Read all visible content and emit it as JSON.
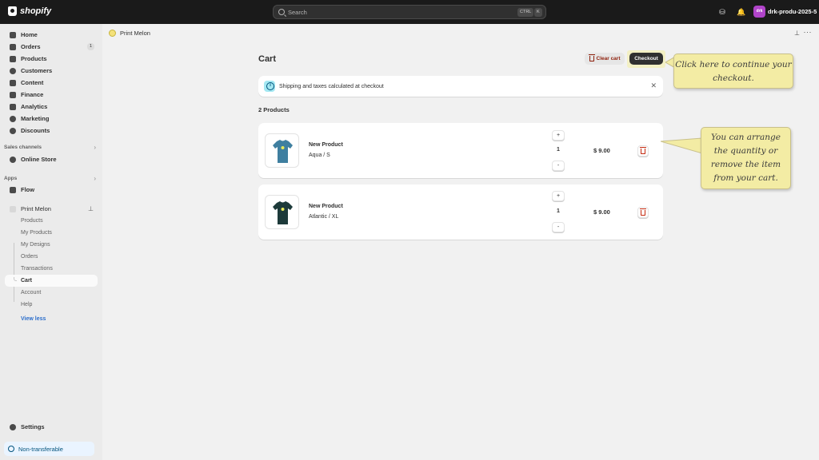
{
  "topbar": {
    "logo_text": "shopify",
    "search_placeholder": "Search",
    "shortcut_key1": "CTRL",
    "shortcut_key2": "K",
    "store_initials": "drk",
    "store_name": "drk-produ-2025-5"
  },
  "sidebar": {
    "nav": [
      {
        "label": "Home",
        "icon": "home-icon"
      },
      {
        "label": "Orders",
        "icon": "orders-icon",
        "badge": "1"
      },
      {
        "label": "Products",
        "icon": "tag-icon"
      },
      {
        "label": "Customers",
        "icon": "person-icon"
      },
      {
        "label": "Content",
        "icon": "content-icon"
      },
      {
        "label": "Finance",
        "icon": "bank-icon"
      },
      {
        "label": "Analytics",
        "icon": "chart-icon"
      },
      {
        "label": "Marketing",
        "icon": "target-icon"
      },
      {
        "label": "Discounts",
        "icon": "discount-icon"
      }
    ],
    "sales_channels_label": "Sales channels",
    "online_store": "Online Store",
    "apps_label": "Apps",
    "flow": "Flow",
    "app_name": "Print Melon",
    "app_sub": [
      "Products",
      "My Products",
      "My Designs",
      "Orders",
      "Transactions"
    ],
    "cart": "Cart",
    "app_sub2": [
      "Account",
      "Help"
    ],
    "view_less": "View less",
    "settings": "Settings",
    "non_transferable": "Non-transferable"
  },
  "app_header": {
    "title": "Print Melon"
  },
  "page": {
    "title": "Cart",
    "clear_cart": "Clear cart",
    "checkout": "Checkout",
    "banner_text": "Shipping and taxes calculated at checkout",
    "count_label": "2 Products"
  },
  "items": [
    {
      "name": "New Product",
      "variant": "Aqua / S",
      "quantity": "1",
      "price": "$ 9.00",
      "shirt_color": "#3f7fa0",
      "plus": "+",
      "minus": "-"
    },
    {
      "name": "New Product",
      "variant": "Atlantic / XL",
      "quantity": "1",
      "price": "$ 9.00",
      "shirt_color": "#1d3a3a",
      "plus": "+",
      "minus": "-"
    }
  ],
  "tooltips": {
    "checkout_tip": "Click here to continue your checkout.",
    "quantity_tip": "You can arrange the quantity or remove the item from your cart."
  }
}
